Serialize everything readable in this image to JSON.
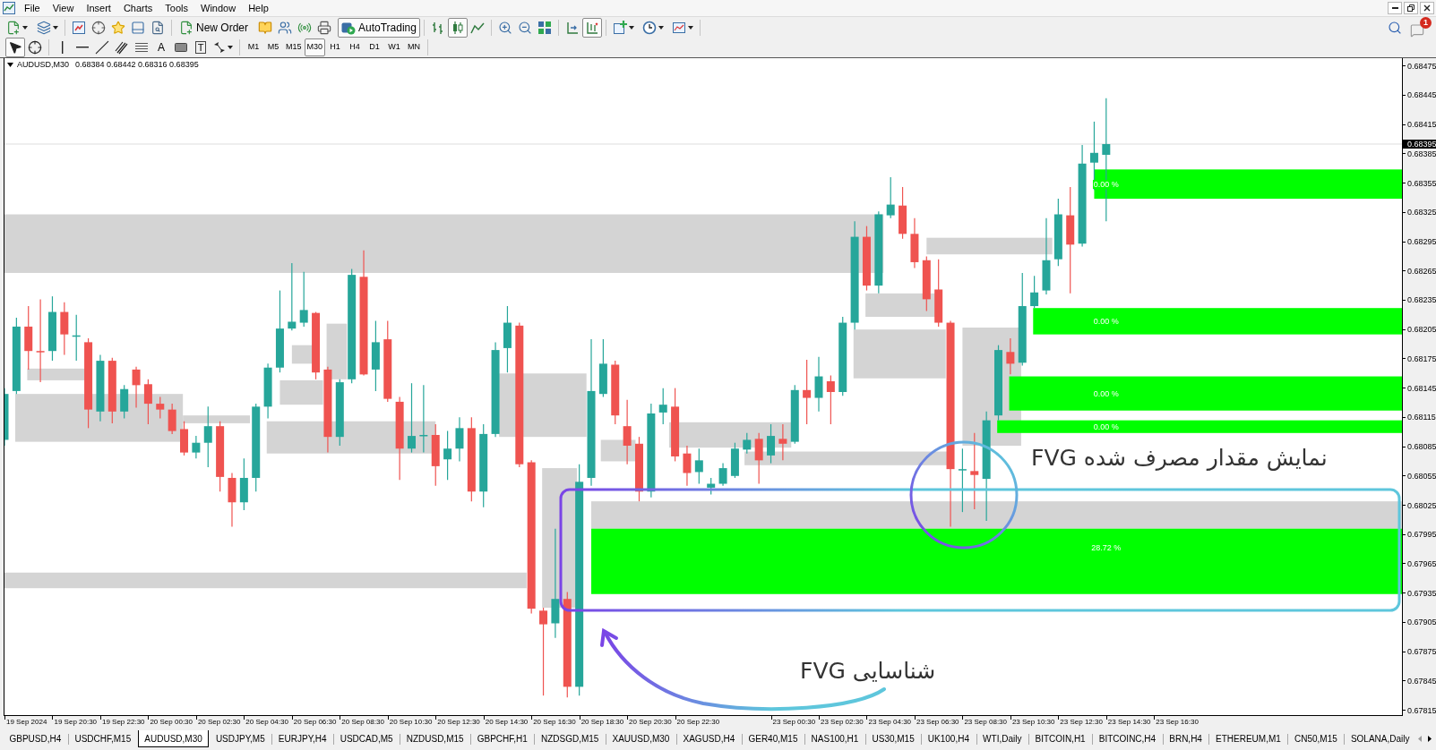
{
  "menu": [
    "File",
    "View",
    "Insert",
    "Charts",
    "Tools",
    "Window",
    "Help"
  ],
  "toolbar": {
    "new_order": "New Order",
    "auto_trading": {
      "label": "AutoTrading",
      "on": true
    },
    "chart_types": [
      {
        "selected": false
      },
      {
        "selected": true
      },
      {
        "selected": false
      }
    ],
    "chart_shift": {
      "on": false
    },
    "auto_scroll": {
      "on": true
    },
    "notifications": "1"
  },
  "drawing_toolbar": {
    "tools": [
      {
        "selected": true
      },
      {
        "selected": false
      }
    ],
    "text_tool": "A",
    "label_tool": "T",
    "periods": [
      {
        "label": "M1",
        "selected": false
      },
      {
        "label": "M5",
        "selected": false
      },
      {
        "label": "M15",
        "selected": false
      },
      {
        "label": "M30",
        "selected": true
      },
      {
        "label": "H1",
        "selected": false
      },
      {
        "label": "H4",
        "selected": false
      },
      {
        "label": "D1",
        "selected": false
      },
      {
        "label": "W1",
        "selected": false
      },
      {
        "label": "MN",
        "selected": false
      }
    ]
  },
  "chart": {
    "symbol": "AUDUSD,M30",
    "ohlc": "0.68384 0.68442 0.68316 0.68395",
    "price_labels": [
      "0.68475",
      "0.68445",
      "0.68415",
      "0.68385",
      "0.68355",
      "0.68325",
      "0.68295",
      "0.68265",
      "0.68235",
      "0.68205",
      "0.68175",
      "0.68145",
      "0.68115",
      "0.68085",
      "0.68055",
      "0.68025",
      "0.67995",
      "0.67965",
      "0.67935",
      "0.67905",
      "0.67875",
      "0.67845",
      "0.67815"
    ],
    "current_price": "0.68395",
    "time_labels": [
      "19 Sep 2024",
      "19 Sep 20:30",
      "19 Sep 22:30",
      "20 Sep 00:30",
      "20 Sep 02:30",
      "20 Sep 04:30",
      "20 Sep 06:30",
      "20 Sep 08:30",
      "20 Sep 10:30",
      "20 Sep 12:30",
      "20 Sep 14:30",
      "20 Sep 16:30",
      "20 Sep 18:30",
      "20 Sep 20:30",
      "20 Sep 22:30",
      "23 Sep 00:30",
      "23 Sep 02:30",
      "23 Sep 04:30",
      "23 Sep 06:30",
      "23 Sep 08:30",
      "23 Sep 10:30",
      "23 Sep 12:30",
      "23 Sep 14:30",
      "23 Sep 16:30"
    ],
    "fvg_labels": [
      "0.00 %",
      "0.00 %",
      "0.00 %",
      "0.00 %",
      "28.72 %"
    ],
    "annotations": [
      "نمایش مقدار مصرف شده FVG",
      "شناسایی FVG"
    ]
  },
  "tabs": [
    {
      "label": "GBPUSD,H4",
      "selected": false
    },
    {
      "label": "USDCHF,M15",
      "selected": false
    },
    {
      "label": "AUDUSD,M30",
      "selected": true
    },
    {
      "label": "USDJPY,M5",
      "selected": false
    },
    {
      "label": "EURJPY,H4",
      "selected": false
    },
    {
      "label": "USDCAD,M5",
      "selected": false
    },
    {
      "label": "NZDUSD,M15",
      "selected": false
    },
    {
      "label": "GBPCHF,H1",
      "selected": false
    },
    {
      "label": "NZDSGD,M15",
      "selected": false
    },
    {
      "label": "XAUUSD,M30",
      "selected": false
    },
    {
      "label": "XAGUSD,H4",
      "selected": false
    },
    {
      "label": "GER40,M15",
      "selected": false
    },
    {
      "label": "NAS100,H1",
      "selected": false
    },
    {
      "label": "US30,M15",
      "selected": false
    },
    {
      "label": "UK100,H4",
      "selected": false
    },
    {
      "label": "WTI,Daily",
      "selected": false
    },
    {
      "label": "BITCOIN,H1",
      "selected": false
    },
    {
      "label": "BITCOINC,H4",
      "selected": false
    },
    {
      "label": "BRN,H4",
      "selected": false
    },
    {
      "label": "ETHEREUM,M1",
      "selected": false
    },
    {
      "label": "CN50,M15",
      "selected": false
    },
    {
      "label": "SOLANA,Daily",
      "selected": false
    }
  ]
}
